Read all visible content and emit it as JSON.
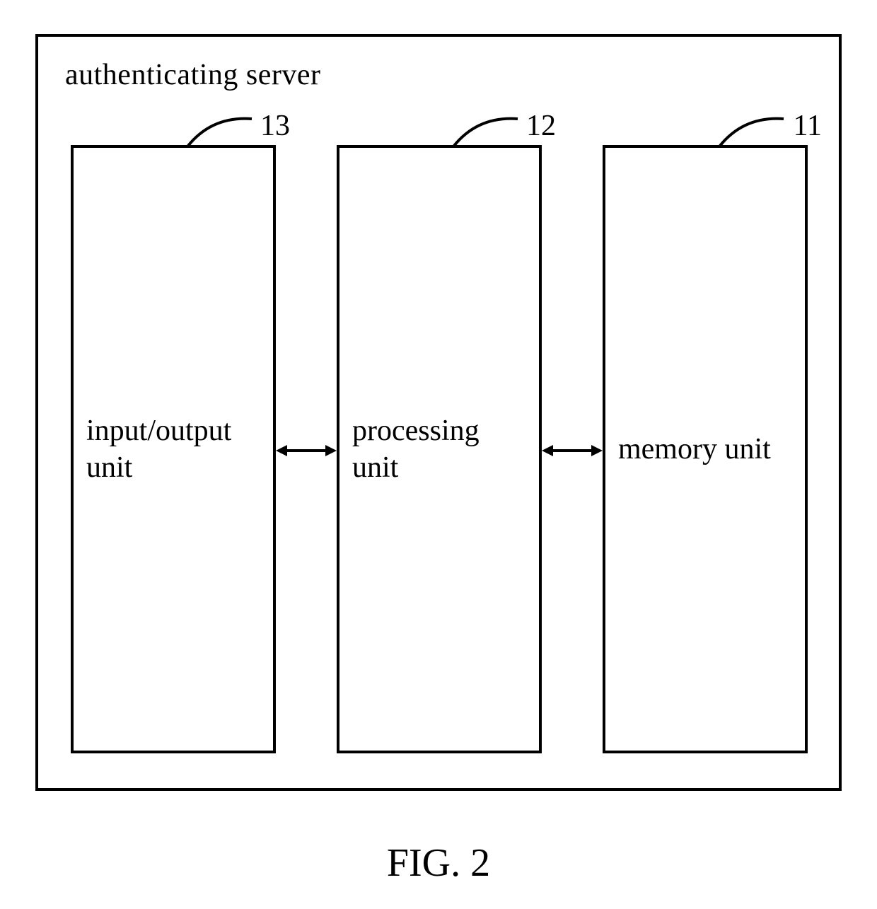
{
  "diagram": {
    "container_label": "authenticating server",
    "units": {
      "left": {
        "ref": "13",
        "label_line1": "input/output",
        "label_line2": "unit"
      },
      "center": {
        "ref": "12",
        "label_line1": "processing",
        "label_line2": "unit"
      },
      "right": {
        "ref": "11",
        "label_line1": "memory unit",
        "label_line2": ""
      }
    },
    "caption": "FIG. 2"
  }
}
